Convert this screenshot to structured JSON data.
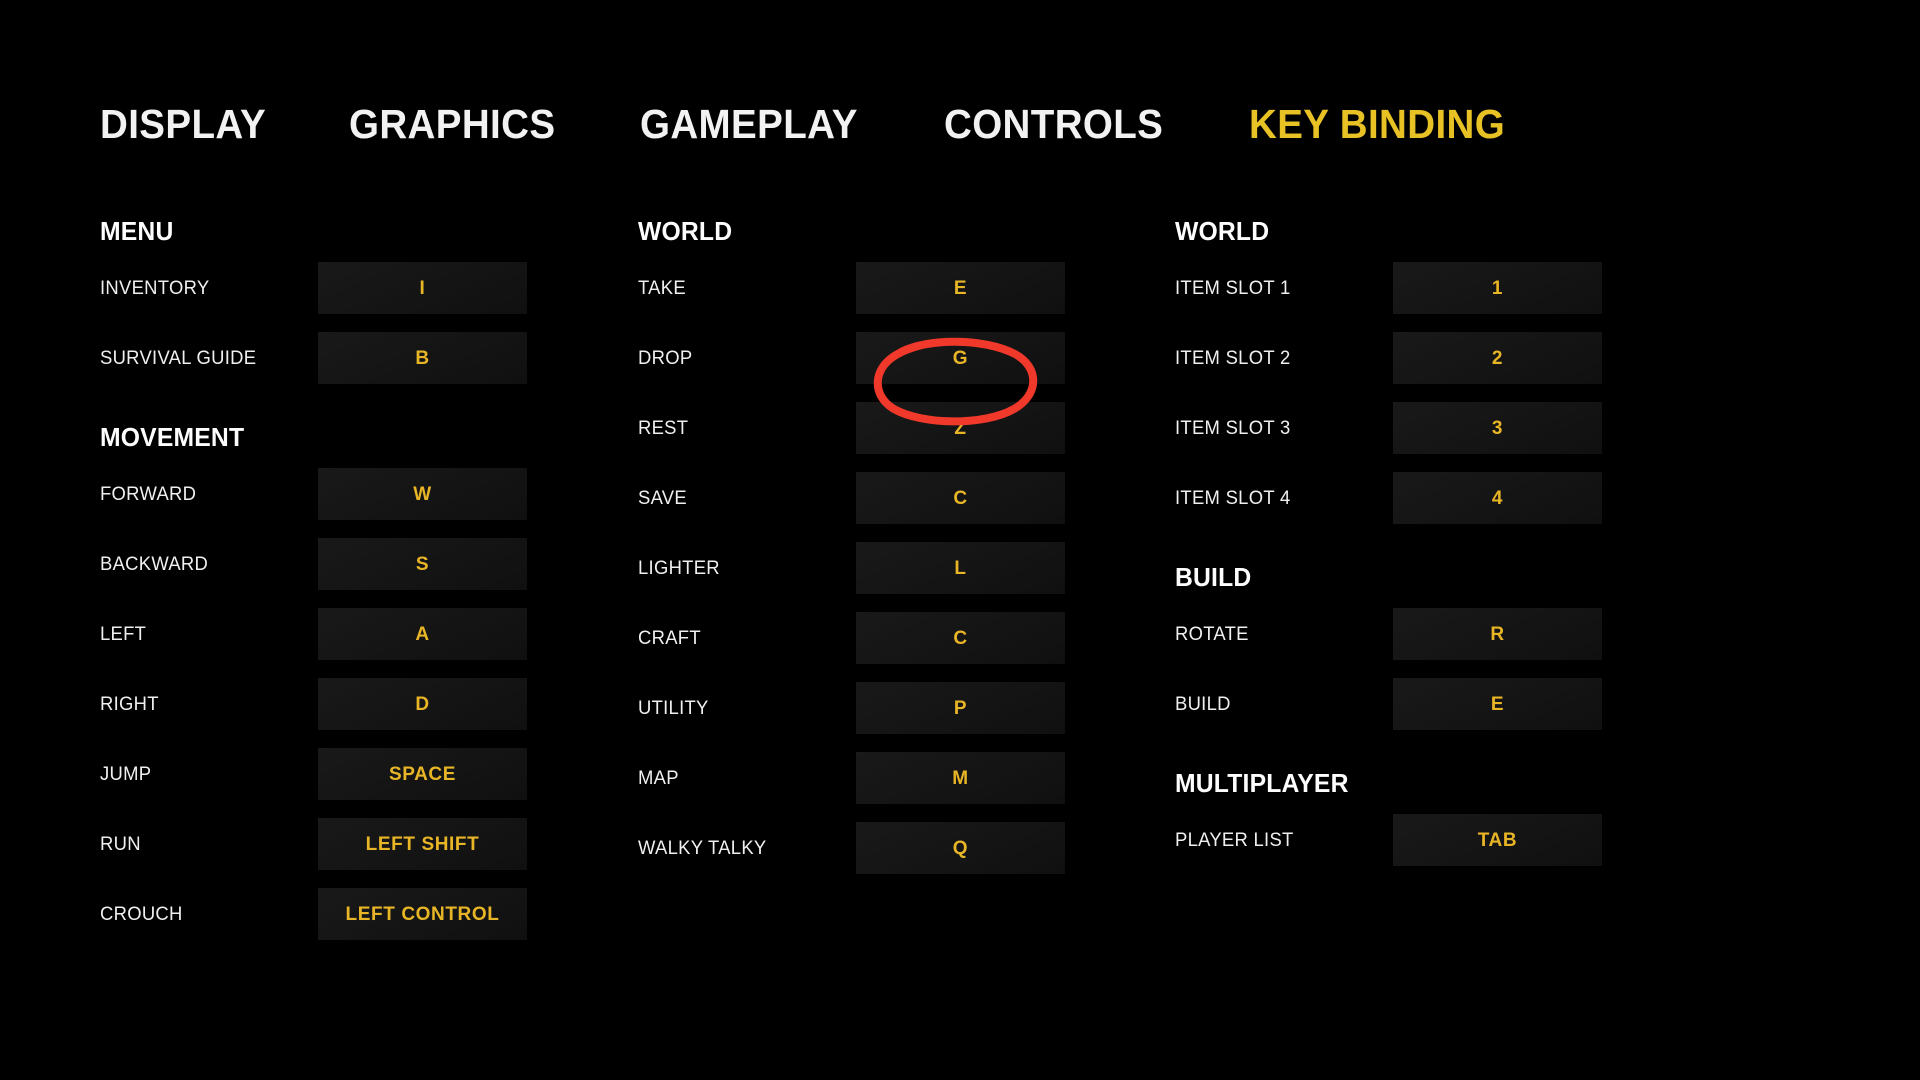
{
  "theme": {
    "background": "#000000",
    "tab_active_color": "#e8c124",
    "tab_inactive_color": "#f2f2f2",
    "key_text_color": "#e8b526",
    "key_box_color": "#161616",
    "label_color": "#f0f0f0",
    "annotation_color": "#f0392b"
  },
  "tabs": [
    {
      "label": "DISPLAY",
      "active": false
    },
    {
      "label": "GRAPHICS",
      "active": false
    },
    {
      "label": "GAMEPLAY",
      "active": false
    },
    {
      "label": "CONTROLS",
      "active": false
    },
    {
      "label": "KEY BINDING",
      "active": true
    }
  ],
  "columns": [
    {
      "sections": [
        {
          "title": "MENU",
          "bindings": [
            {
              "action": "INVENTORY",
              "key": "I"
            },
            {
              "action": "SURVIVAL GUIDE",
              "key": "B"
            }
          ]
        },
        {
          "title": "MOVEMENT",
          "bindings": [
            {
              "action": "FORWARD",
              "key": "W"
            },
            {
              "action": "BACKWARD",
              "key": "S"
            },
            {
              "action": "LEFT",
              "key": "A"
            },
            {
              "action": "RIGHT",
              "key": "D"
            },
            {
              "action": "JUMP",
              "key": "SPACE"
            },
            {
              "action": "RUN",
              "key": "LEFT SHIFT"
            },
            {
              "action": "CROUCH",
              "key": "LEFT CONTROL"
            }
          ]
        }
      ]
    },
    {
      "sections": [
        {
          "title": "WORLD",
          "bindings": [
            {
              "action": "TAKE",
              "key": "E"
            },
            {
              "action": "DROP",
              "key": "G"
            },
            {
              "action": "REST",
              "key": "Z"
            },
            {
              "action": "SAVE",
              "key": "C"
            },
            {
              "action": "LIGHTER",
              "key": "L"
            },
            {
              "action": "CRAFT",
              "key": "C"
            },
            {
              "action": "UTILITY",
              "key": "P"
            },
            {
              "action": "MAP",
              "key": "M"
            },
            {
              "action": "WALKY TALKY",
              "key": "Q"
            }
          ]
        }
      ]
    },
    {
      "sections": [
        {
          "title": "WORLD",
          "bindings": [
            {
              "action": "ITEM SLOT 1",
              "key": "1"
            },
            {
              "action": "ITEM SLOT 2",
              "key": "2"
            },
            {
              "action": "ITEM SLOT 3",
              "key": "3"
            },
            {
              "action": "ITEM SLOT 4",
              "key": "4"
            }
          ]
        },
        {
          "title": "BUILD",
          "bindings": [
            {
              "action": "ROTATE",
              "key": "R"
            },
            {
              "action": "BUILD",
              "key": "E"
            }
          ]
        },
        {
          "title": "MULTIPLAYER",
          "bindings": [
            {
              "action": "PLAYER LIST",
              "key": "TAB"
            }
          ]
        }
      ]
    }
  ],
  "annotation": {
    "shape": "hand-drawn-red-ellipse",
    "targets": "DROP key binding"
  }
}
